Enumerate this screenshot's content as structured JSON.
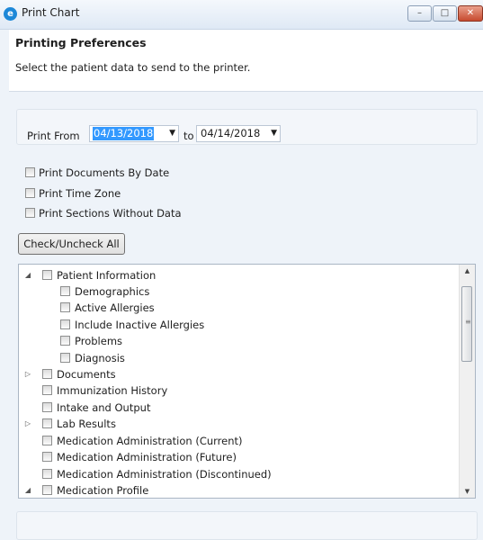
{
  "window": {
    "title": "Print Chart",
    "minimize_label": "–",
    "maximize_label": "□",
    "close_label": "✕"
  },
  "header": {
    "title": "Printing Preferences",
    "subtitle": "Select the patient data to send to the printer."
  },
  "range": {
    "from_label": "Print From",
    "from_value": "04/13/2018",
    "to_label": "to",
    "to_value": "04/14/2018"
  },
  "options": [
    {
      "label": "Print Documents By Date",
      "checked": false
    },
    {
      "label": "Print Time Zone",
      "checked": false
    },
    {
      "label": "Print Sections Without Data",
      "checked": false
    }
  ],
  "check_all_label": "Check/Uncheck All",
  "tree": {
    "items": [
      {
        "label": "Patient Information",
        "expander": "expanded",
        "level": 0
      },
      {
        "label": "Demographics",
        "expander": "none",
        "level": 1
      },
      {
        "label": "Active Allergies",
        "expander": "none",
        "level": 1
      },
      {
        "label": "Include Inactive Allergies",
        "expander": "none",
        "level": 1
      },
      {
        "label": "Problems",
        "expander": "none",
        "level": 1
      },
      {
        "label": "Diagnosis",
        "expander": "none",
        "level": 1
      },
      {
        "label": "Documents",
        "expander": "collapsed",
        "level": 0
      },
      {
        "label": "Immunization History",
        "expander": "none",
        "level": 0
      },
      {
        "label": "Intake and Output",
        "expander": "none",
        "level": 0
      },
      {
        "label": "Lab Results",
        "expander": "collapsed",
        "level": 0
      },
      {
        "label": "Medication Administration (Current)",
        "expander": "none",
        "level": 0
      },
      {
        "label": "Medication Administration (Future)",
        "expander": "none",
        "level": 0
      },
      {
        "label": "Medication Administration (Discontinued)",
        "expander": "none",
        "level": 0
      },
      {
        "label": "Medication Profile",
        "expander": "expanded",
        "level": 0
      }
    ]
  }
}
